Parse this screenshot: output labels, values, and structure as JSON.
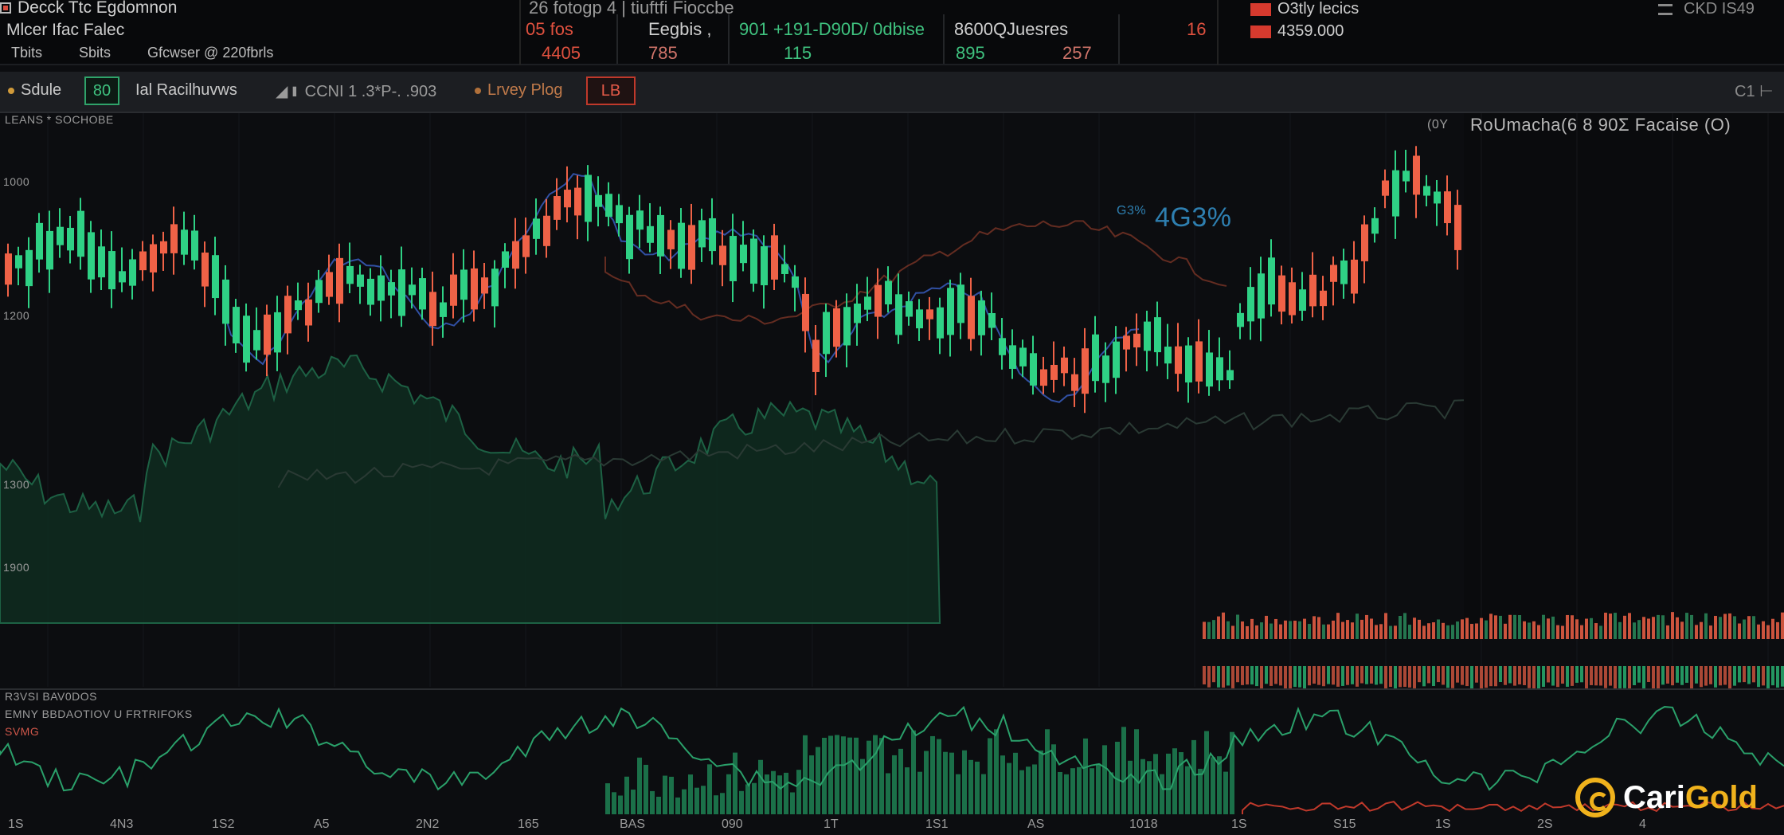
{
  "header": {
    "title": "Decck Ttc Egdomnon",
    "subtitle": "Mlcer Ifac Falec",
    "tabs": [
      "Tbits",
      "Sbits",
      "Gfcwser @ 220fbrls"
    ],
    "quote_bar_title": "26 fotogp 4 | tiuftfi Fioccbe",
    "quote_cells": [
      {
        "label": "05 fos",
        "color": "#e0513f"
      },
      {
        "label": "Eegbis ,",
        "color": "#cfcfcf"
      },
      {
        "label": "901 +191-D90D/ 0dbise",
        "color": "#3fc27f"
      },
      {
        "label": "8600QJuesres",
        "color": "#cfcfcf"
      },
      {
        "label": "16",
        "color": "#e0513f"
      }
    ],
    "quote_cells_row2": [
      {
        "label": "4405",
        "color": "#e0513f"
      },
      {
        "label": "785",
        "color": "#d0746a"
      },
      {
        "label": "115",
        "color": "#3fc27f"
      },
      {
        "label": "895",
        "color": "#3fc27f"
      },
      {
        "label": "257",
        "color": "#d0746a"
      }
    ],
    "right_labels": [
      "O3tly lecics",
      "4359.000"
    ],
    "right_corner": "CKD IS49",
    "right_icon": "filter-icon"
  },
  "toolbar": {
    "items": [
      "Sdule",
      "80",
      "Ial Racilhuvws",
      "CCNI 1 .3*P-. .903",
      "Lrvey Plog",
      "LB"
    ],
    "right_item": "C1"
  },
  "chart": {
    "top_label": "LEANS * SOCHOBE",
    "left_ticks": [
      "1000",
      "1200",
      "1300",
      "1900"
    ],
    "right_title": "RoUmacha(6 8 90Σ Facaise (O)",
    "right_small": "(0Y",
    "annotation": "4G3%",
    "annotation_small": "G3%",
    "accent_up": "#2fd185",
    "accent_down": "#ef6247"
  },
  "chart_data": {
    "type": "line",
    "title": "",
    "series": [],
    "xlabel": "",
    "ylabel": ""
  },
  "lower_panel": {
    "label1": "R3VSI BAV0DOS",
    "label2": "EMNY BBDAOTIOV U FRTRIFOKS",
    "label3": "SVMG"
  },
  "xaxis": {
    "ticks": [
      "1S",
      "4N3",
      "1S2",
      "A5",
      "2N2",
      "165",
      "BAS",
      "090",
      "1T",
      "1S1",
      "AS",
      "1018",
      "1S",
      "S15",
      "1S",
      "2S",
      "4"
    ]
  },
  "watermark": {
    "brand": "CariGold",
    "brand_a": "Cari",
    "brand_b": "Gold"
  }
}
